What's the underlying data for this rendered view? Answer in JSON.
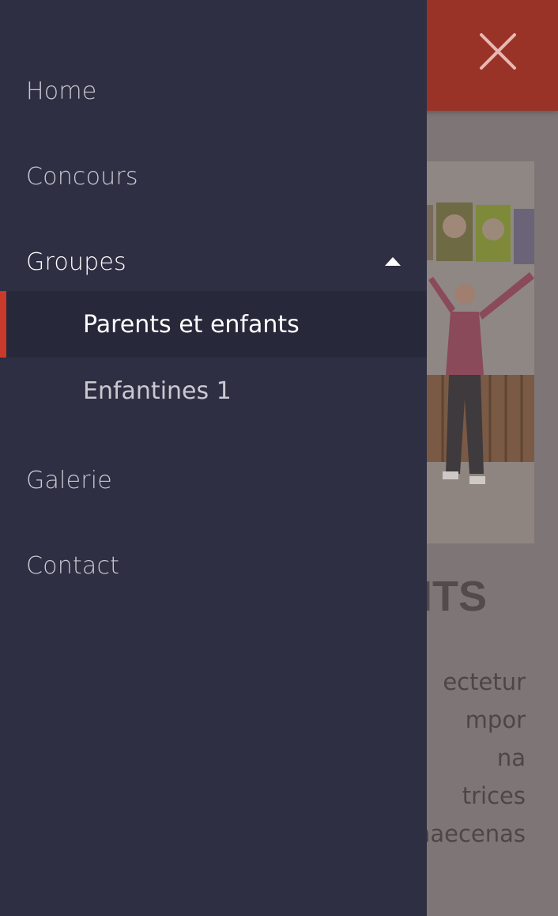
{
  "drawer": {
    "items": [
      {
        "label": "Home"
      },
      {
        "label": "Concours"
      },
      {
        "label": "Groupes",
        "expanded": true,
        "icon": "caret-up-icon",
        "children": [
          {
            "label": "Parents et enfants",
            "active": true
          },
          {
            "label": "Enfantines 1"
          }
        ]
      },
      {
        "label": "Galerie"
      },
      {
        "label": "Contact"
      }
    ]
  },
  "header": {
    "close_icon": "close-icon",
    "accent_color": "#9a3327"
  },
  "page": {
    "heading_visible": "NTS",
    "paragraph_lines": [
      "ectetur",
      "mpor",
      "na",
      "trices",
      "naecenas"
    ]
  },
  "colors": {
    "drawer_bg": "#2e2f42",
    "active_bg": "#27283a",
    "active_indicator": "#c93a2a"
  }
}
